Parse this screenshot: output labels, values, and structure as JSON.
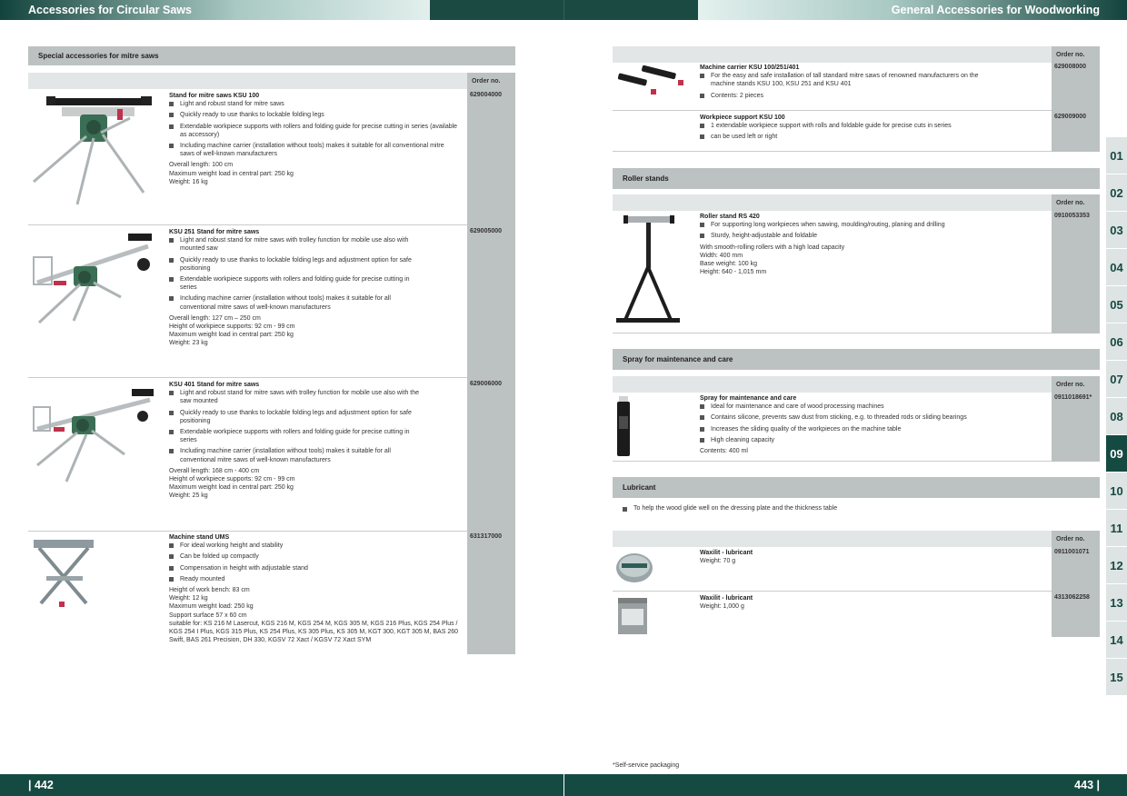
{
  "header": {
    "left_title": "Accessories for Circular Saws",
    "right_title": "General Accessories for Woodworking"
  },
  "footer": {
    "left_page": "| 442",
    "right_page": "443 |"
  },
  "tabs": [
    "01",
    "02",
    "03",
    "04",
    "05",
    "06",
    "07",
    "08",
    "09",
    "10",
    "11",
    "12",
    "13",
    "14",
    "15"
  ],
  "active_tab": "09",
  "left": {
    "section_title": "Special accessories for mitre saws",
    "order_label": "Order no.",
    "products": [
      {
        "title": "Stand for mitre saws KSU 100",
        "bullets": [
          "Light and robust stand for mitre saws",
          "Quickly ready to use thanks to lockable folding legs",
          "Extendable workpiece supports with rollers and folding guide for precise cutting in series (available as accessory)",
          "Including machine carrier (installation without tools) makes it suitable for all conventional mitre saws of well-known manufacturers"
        ],
        "specs": [
          "Overall length: 100 cm",
          "Maximum weight load in central part: 250 kg",
          "Weight: 16 kg"
        ],
        "order": "629004000"
      },
      {
        "title": "KSU 251 Stand for mitre saws",
        "bullets": [
          "Light and robust stand for mitre saws with trolley function for mobile use also with mounted saw",
          "Quickly ready to use thanks to lockable folding legs and adjustment option for safe positioning",
          "Extendable workpiece supports with rollers and folding guide for precise cutting in series",
          "Including machine carrier (installation without tools) makes it suitable for all conventional mitre saws of well-known manufacturers"
        ],
        "specs": [
          "Overall length: 127 cm – 250 cm",
          "Height of workpiece supports: 92 cm - 99 cm",
          "Maximum weight load in central part: 250 kg",
          "Weight: 23 kg"
        ],
        "order": "629005000"
      },
      {
        "title": "KSU 401 Stand for mitre saws",
        "bullets": [
          "Light and robust stand for mitre saws with trolley function for mobile use also with the saw mounted",
          "Quickly ready to use thanks to lockable folding legs and adjustment option for safe positioning",
          "Extendable workpiece supports with rollers and folding guide for precise cutting in series",
          "Including machine carrier (installation without tools) makes it suitable for all conventional mitre saws of well-known manufacturers"
        ],
        "specs": [
          "Overall length: 168 cm - 400 cm",
          "Height of workpiece supports: 92 cm - 99 cm",
          "Maximum weight load in central part: 250 kg",
          "Weight: 25 kg"
        ],
        "order": "629006000"
      },
      {
        "title": "Machine stand UMS",
        "bullets": [
          "For ideal working height and stability",
          "Can be folded up compactly",
          "Compensation in height with adjustable stand",
          "Ready mounted"
        ],
        "specs": [
          "Height of work bench: 83 cm",
          "Weight: 12 kg",
          "Maximum weight load: 250 kg",
          "Support surface 57 x 60 cm",
          "suitable for: KS 216 M Lasercut, KGS 216 M, KGS 254 M, KGS 305 M, KGS 216 Plus, KGS 254 Plus / KGS 254 I Plus, KGS 315 Plus, KS 254 Plus, KS 305 Plus, KS 305 M, KGT 300, KGT 305 M, BAS 260 Swift, BAS 261 Precision, DH 330, KGSV 72 Xact / KGSV 72 Xact SYM"
        ],
        "order": "631317000"
      }
    ]
  },
  "right": {
    "order_label": "Order no.",
    "carriers": [
      {
        "title": "Machine carrier KSU 100/251/401",
        "bullets": [
          "For the easy and safe installation of tall standard mitre saws of renowned manufacturers on the machine stands KSU 100, KSU 251 and KSU 401",
          "Contents: 2 pieces"
        ],
        "specs": [],
        "order": "629008000"
      },
      {
        "title": "Workpiece support KSU 100",
        "bullets": [
          "1 extendable workpiece support with rolls and foldable guide for precise cuts in series",
          "can be used left or right"
        ],
        "specs": [],
        "order": "629009000"
      }
    ],
    "roller_section_title": "Roller stands",
    "roller": {
      "title": "Roller stand RS 420",
      "bullets": [
        "For supporting long workpieces when sawing, moulding/routing, planing and drilling",
        "Sturdy, height-adjustable and foldable"
      ],
      "specs": [
        "With smooth-rolling rollers with a high load capacity",
        "Width: 400 mm",
        "Base weight: 100 kg",
        "Height: 640 - 1,015 mm"
      ],
      "order": "0910053353"
    },
    "spray_section_title": "Spray for maintenance and care",
    "spray": {
      "title": "Spray for maintenance and care",
      "bullets": [
        "Ideal for maintenance and care of wood processing machines",
        "Contains silicone, prevents saw dust from sticking, e.g. to threaded rods or sliding bearings",
        "Increases the sliding quality of the workpieces on the machine table",
        "High cleaning capacity"
      ],
      "specs": [
        "Contents: 400 ml"
      ],
      "order": "0911018691*"
    },
    "lubricant_section_title": "Lubricant",
    "lubricant_note": "To help the wood glide well on the dressing plate and the thickness table",
    "waxilit": [
      {
        "title": "Waxilit - lubricant",
        "spec": "Weight: 70 g",
        "order": "0911001071"
      },
      {
        "title": "Waxilit - lubricant",
        "spec": "Weight: 1,000 g",
        "order": "4313062258"
      }
    ],
    "footnote": "*Self-service packaging"
  }
}
